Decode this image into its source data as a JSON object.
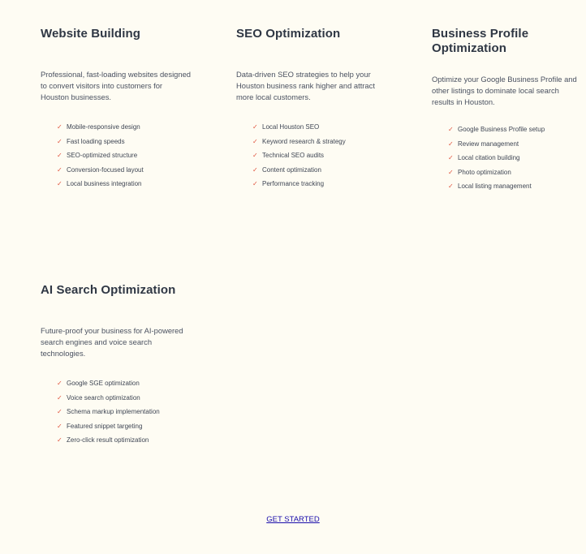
{
  "services": [
    {
      "title": "Website Building",
      "description": "Professional, fast-loading websites designed to convert visitors into customers for Houston businesses.",
      "features": [
        "Mobile-responsive design",
        "Fast loading speeds",
        "SEO-optimized structure",
        "Conversion-focused layout",
        "Local business integration"
      ]
    },
    {
      "title": "SEO Optimization",
      "description": "Data-driven SEO strategies to help your Houston business rank higher and attract more local customers.",
      "features": [
        "Local Houston SEO",
        "Keyword research & strategy",
        "Technical SEO audits",
        "Content optimization",
        "Performance tracking"
      ]
    },
    {
      "title": "Business Profile Optimization",
      "description": "Optimize your Google Business Profile and other listings to dominate local search results in Houston.",
      "features": [
        "Google Business Profile setup",
        "Review management",
        "Local citation building",
        "Photo optimization",
        "Local listing management"
      ]
    },
    {
      "title": "AI Search Optimization",
      "description": "Future-proof your business for AI-powered search engines and voice search technologies.",
      "features": [
        "Google SGE optimization",
        "Voice search optimization",
        "Schema markup implementation",
        "Featured snippet targeting",
        "Zero-click result optimization"
      ]
    }
  ],
  "check_glyph": "✓",
  "check_color": "#e0533d",
  "cta": {
    "label": "GET STARTED"
  }
}
